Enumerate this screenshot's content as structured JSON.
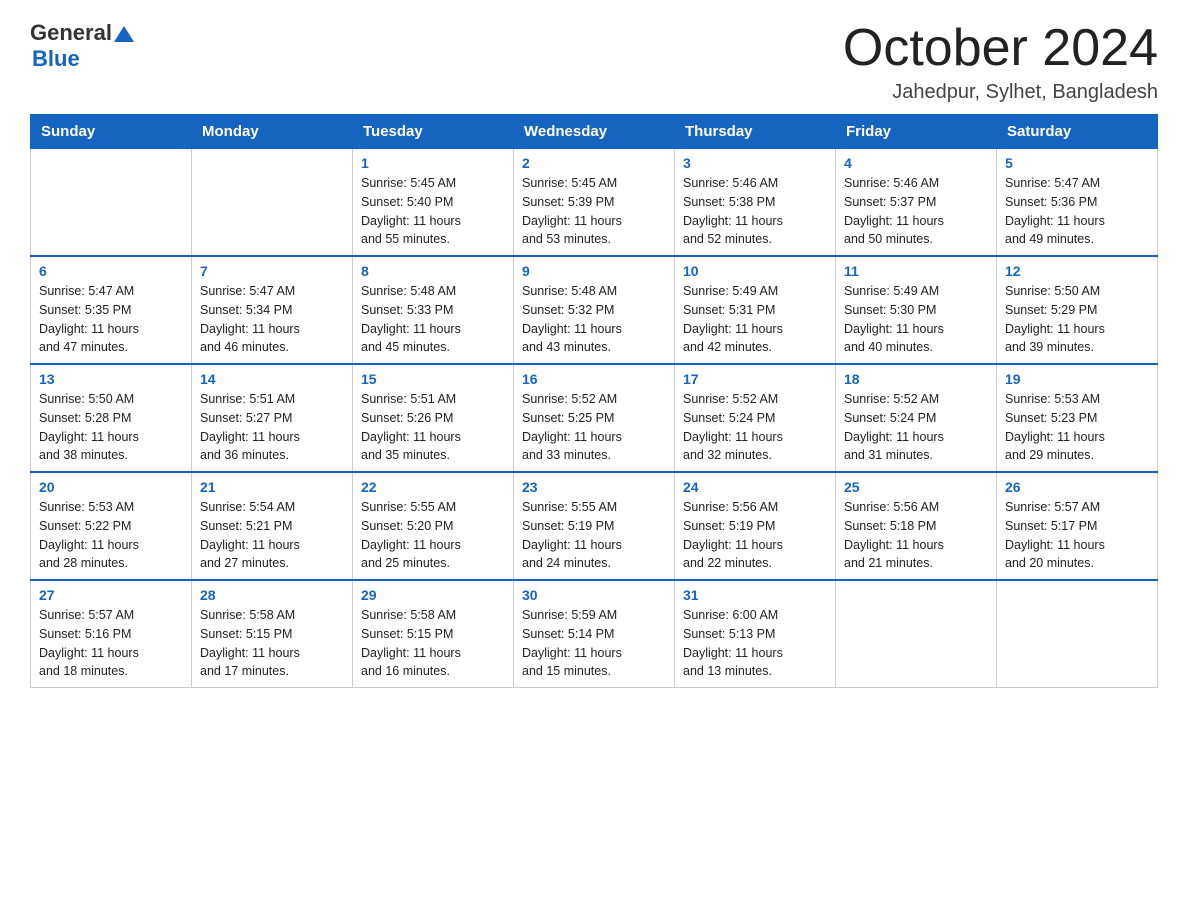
{
  "header": {
    "logo_general": "General",
    "logo_blue": "Blue",
    "month_title": "October 2024",
    "location": "Jahedpur, Sylhet, Bangladesh"
  },
  "days_of_week": [
    "Sunday",
    "Monday",
    "Tuesday",
    "Wednesday",
    "Thursday",
    "Friday",
    "Saturday"
  ],
  "weeks": [
    [
      {
        "day": "",
        "info": ""
      },
      {
        "day": "",
        "info": ""
      },
      {
        "day": "1",
        "info": "Sunrise: 5:45 AM\nSunset: 5:40 PM\nDaylight: 11 hours\nand 55 minutes."
      },
      {
        "day": "2",
        "info": "Sunrise: 5:45 AM\nSunset: 5:39 PM\nDaylight: 11 hours\nand 53 minutes."
      },
      {
        "day": "3",
        "info": "Sunrise: 5:46 AM\nSunset: 5:38 PM\nDaylight: 11 hours\nand 52 minutes."
      },
      {
        "day": "4",
        "info": "Sunrise: 5:46 AM\nSunset: 5:37 PM\nDaylight: 11 hours\nand 50 minutes."
      },
      {
        "day": "5",
        "info": "Sunrise: 5:47 AM\nSunset: 5:36 PM\nDaylight: 11 hours\nand 49 minutes."
      }
    ],
    [
      {
        "day": "6",
        "info": "Sunrise: 5:47 AM\nSunset: 5:35 PM\nDaylight: 11 hours\nand 47 minutes."
      },
      {
        "day": "7",
        "info": "Sunrise: 5:47 AM\nSunset: 5:34 PM\nDaylight: 11 hours\nand 46 minutes."
      },
      {
        "day": "8",
        "info": "Sunrise: 5:48 AM\nSunset: 5:33 PM\nDaylight: 11 hours\nand 45 minutes."
      },
      {
        "day": "9",
        "info": "Sunrise: 5:48 AM\nSunset: 5:32 PM\nDaylight: 11 hours\nand 43 minutes."
      },
      {
        "day": "10",
        "info": "Sunrise: 5:49 AM\nSunset: 5:31 PM\nDaylight: 11 hours\nand 42 minutes."
      },
      {
        "day": "11",
        "info": "Sunrise: 5:49 AM\nSunset: 5:30 PM\nDaylight: 11 hours\nand 40 minutes."
      },
      {
        "day": "12",
        "info": "Sunrise: 5:50 AM\nSunset: 5:29 PM\nDaylight: 11 hours\nand 39 minutes."
      }
    ],
    [
      {
        "day": "13",
        "info": "Sunrise: 5:50 AM\nSunset: 5:28 PM\nDaylight: 11 hours\nand 38 minutes."
      },
      {
        "day": "14",
        "info": "Sunrise: 5:51 AM\nSunset: 5:27 PM\nDaylight: 11 hours\nand 36 minutes."
      },
      {
        "day": "15",
        "info": "Sunrise: 5:51 AM\nSunset: 5:26 PM\nDaylight: 11 hours\nand 35 minutes."
      },
      {
        "day": "16",
        "info": "Sunrise: 5:52 AM\nSunset: 5:25 PM\nDaylight: 11 hours\nand 33 minutes."
      },
      {
        "day": "17",
        "info": "Sunrise: 5:52 AM\nSunset: 5:24 PM\nDaylight: 11 hours\nand 32 minutes."
      },
      {
        "day": "18",
        "info": "Sunrise: 5:52 AM\nSunset: 5:24 PM\nDaylight: 11 hours\nand 31 minutes."
      },
      {
        "day": "19",
        "info": "Sunrise: 5:53 AM\nSunset: 5:23 PM\nDaylight: 11 hours\nand 29 minutes."
      }
    ],
    [
      {
        "day": "20",
        "info": "Sunrise: 5:53 AM\nSunset: 5:22 PM\nDaylight: 11 hours\nand 28 minutes."
      },
      {
        "day": "21",
        "info": "Sunrise: 5:54 AM\nSunset: 5:21 PM\nDaylight: 11 hours\nand 27 minutes."
      },
      {
        "day": "22",
        "info": "Sunrise: 5:55 AM\nSunset: 5:20 PM\nDaylight: 11 hours\nand 25 minutes."
      },
      {
        "day": "23",
        "info": "Sunrise: 5:55 AM\nSunset: 5:19 PM\nDaylight: 11 hours\nand 24 minutes."
      },
      {
        "day": "24",
        "info": "Sunrise: 5:56 AM\nSunset: 5:19 PM\nDaylight: 11 hours\nand 22 minutes."
      },
      {
        "day": "25",
        "info": "Sunrise: 5:56 AM\nSunset: 5:18 PM\nDaylight: 11 hours\nand 21 minutes."
      },
      {
        "day": "26",
        "info": "Sunrise: 5:57 AM\nSunset: 5:17 PM\nDaylight: 11 hours\nand 20 minutes."
      }
    ],
    [
      {
        "day": "27",
        "info": "Sunrise: 5:57 AM\nSunset: 5:16 PM\nDaylight: 11 hours\nand 18 minutes."
      },
      {
        "day": "28",
        "info": "Sunrise: 5:58 AM\nSunset: 5:15 PM\nDaylight: 11 hours\nand 17 minutes."
      },
      {
        "day": "29",
        "info": "Sunrise: 5:58 AM\nSunset: 5:15 PM\nDaylight: 11 hours\nand 16 minutes."
      },
      {
        "day": "30",
        "info": "Sunrise: 5:59 AM\nSunset: 5:14 PM\nDaylight: 11 hours\nand 15 minutes."
      },
      {
        "day": "31",
        "info": "Sunrise: 6:00 AM\nSunset: 5:13 PM\nDaylight: 11 hours\nand 13 minutes."
      },
      {
        "day": "",
        "info": ""
      },
      {
        "day": "",
        "info": ""
      }
    ]
  ]
}
